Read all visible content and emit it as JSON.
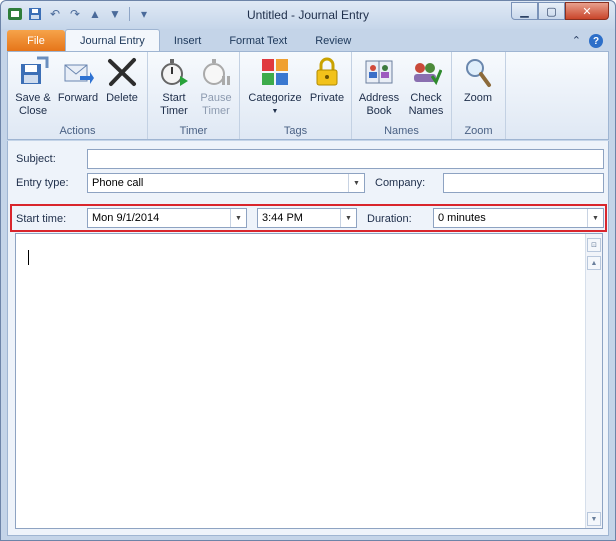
{
  "window": {
    "title": "Untitled  -  Journal Entry"
  },
  "qat": {
    "icons": [
      "outlook-icon",
      "save-icon",
      "undo-icon",
      "redo-icon",
      "up-icon",
      "down-icon",
      "customize-icon"
    ]
  },
  "tabs": [
    {
      "label": "File"
    },
    {
      "label": "Journal Entry"
    },
    {
      "label": "Insert"
    },
    {
      "label": "Format Text"
    },
    {
      "label": "Review"
    }
  ],
  "ribbon": {
    "groups": {
      "actions": {
        "label": "Actions",
        "save_close": "Save &\nClose",
        "forward": "Forward",
        "delete": "Delete"
      },
      "timer": {
        "label": "Timer",
        "start": "Start\nTimer",
        "pause": "Pause\nTimer"
      },
      "tags": {
        "label": "Tags",
        "categorize": "Categorize",
        "private": "Private"
      },
      "names": {
        "label": "Names",
        "address_book": "Address\nBook",
        "check_names": "Check\nNames"
      },
      "zoom": {
        "label": "Zoom",
        "zoom": "Zoom"
      }
    }
  },
  "form": {
    "subject_label": "Subject:",
    "subject_value": "",
    "entry_type_label": "Entry type:",
    "entry_type_value": "Phone call",
    "company_label": "Company:",
    "company_value": "",
    "start_time_label": "Start time:",
    "start_date_value": "Mon 9/1/2014",
    "start_time_value": "3:44 PM",
    "duration_label": "Duration:",
    "duration_value": "0 minutes"
  },
  "colors": {
    "file_tab": "#e57317",
    "highlight_border": "#d9252c"
  }
}
